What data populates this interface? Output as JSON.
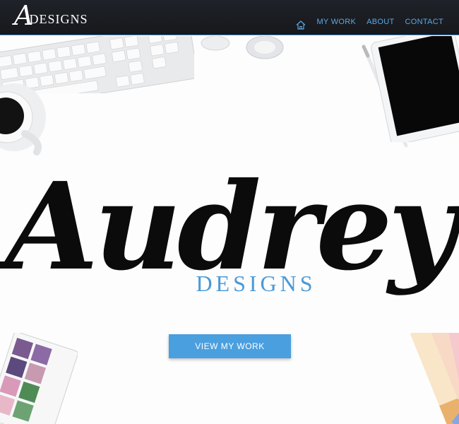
{
  "logo": {
    "mark": "A",
    "rest": "DESIGNS"
  },
  "nav": {
    "home_icon": "home-icon",
    "items": [
      {
        "label": "MY WORK"
      },
      {
        "label": "ABOUT"
      },
      {
        "label": "CONTACT"
      }
    ]
  },
  "hero": {
    "title": "Audrey",
    "subtitle": "DESIGNS",
    "cta_label": "VIEW MY WORK"
  },
  "colors": {
    "nav_bg": "#1a1c20",
    "nav_accent": "#4a9fdf",
    "title": "#0b0b0b",
    "subtitle": "#4a9ad8",
    "cta_bg": "#4a9fdf"
  }
}
